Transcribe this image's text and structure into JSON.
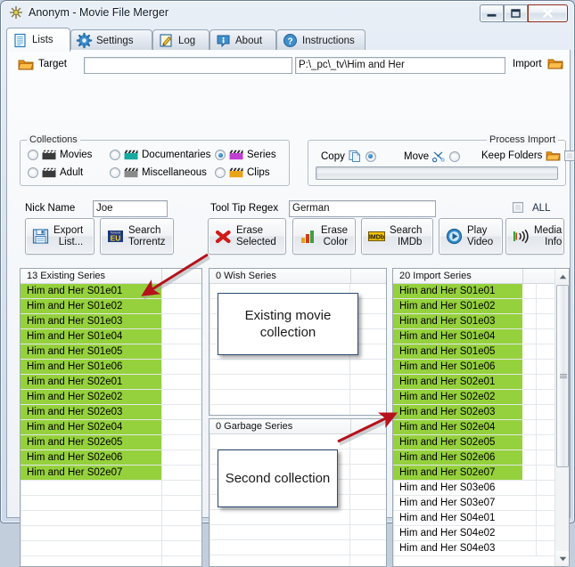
{
  "window": {
    "title": "Anonym - Movie File Merger",
    "icon": "app-star-icon",
    "buttons": {
      "minimize": "minimize-icon",
      "maximize": "maximize-icon",
      "close": "close-icon"
    }
  },
  "tabs": [
    {
      "label": "Lists",
      "icon": "document-icon",
      "active": true
    },
    {
      "label": "Settings",
      "icon": "gear-icon",
      "active": false
    },
    {
      "label": "Log",
      "icon": "pencil-note-icon",
      "active": false
    },
    {
      "label": "About",
      "icon": "info-bubble-icon",
      "active": false
    },
    {
      "label": "Instructions",
      "icon": "question-icon",
      "active": false
    }
  ],
  "target_row": {
    "folder_icon": "folder-icon",
    "label": "Target",
    "target_value": "",
    "target_placeholder": "",
    "import_path": "P:\\_pc\\_tv\\Him and Her",
    "import_label": "Import",
    "import_icon": "folder-icon"
  },
  "collections": {
    "title": "Collections",
    "items": [
      {
        "label": "Movies",
        "selected": false,
        "icon_color": "#3a3a3a"
      },
      {
        "label": "Documentaries",
        "selected": false,
        "icon_color": "#17a9a0"
      },
      {
        "label": "Series",
        "selected": true,
        "icon_color": "#c03fd0"
      },
      {
        "label": "Adult",
        "selected": false,
        "icon_color": "#3a3a3a"
      },
      {
        "label": "Miscellaneous",
        "selected": false,
        "icon_color": "#8a8a8a"
      },
      {
        "label": "Clips",
        "selected": false,
        "icon_color": "#e8a317"
      }
    ]
  },
  "process_import": {
    "title": "Process Import",
    "copy_label": "Copy",
    "copy_icon": "copy-pages-icon",
    "copy_selected": true,
    "move_label": "Move",
    "move_icon": "scissors-icon",
    "move_selected": false,
    "keep_folders_label": "Keep Folders",
    "keep_folders_icon": "folder-icon",
    "keep_folders_checked": false,
    "progress_percent": 0
  },
  "filters": {
    "nick_name_label": "Nick Name",
    "nick_name_value": "Joe",
    "regex_label": "Tool Tip Regex",
    "regex_value": "German",
    "all_label": "ALL",
    "all_checked": false
  },
  "buttons": [
    {
      "name": "export-list",
      "line1": "Export",
      "line2": "List...",
      "icon": "floppy-disk-icon"
    },
    {
      "name": "search-torrentz",
      "line1": "Search",
      "line2": "Torrentz",
      "icon": "torrentz-eu-icon"
    },
    {
      "name": "erase-selected",
      "line1": "Erase",
      "line2": "Selected",
      "icon": "red-x-icon"
    },
    {
      "name": "erase-color",
      "line1": "Erase",
      "line2": "Color",
      "icon": "bar-chart-icon"
    },
    {
      "name": "search-imdb",
      "line1": "Search",
      "line2": "IMDb",
      "icon": "imdb-icon"
    },
    {
      "name": "play-video",
      "line1": "Play",
      "line2": "Video",
      "icon": "play-icon"
    },
    {
      "name": "media-info",
      "line1": "Media",
      "line2": "Info",
      "icon": "media-info-icon"
    }
  ],
  "lists": {
    "existing": {
      "header": "13 Existing Series",
      "rows": [
        {
          "text": "Him and Her S01e01",
          "highlight": true
        },
        {
          "text": "Him and Her S01e02",
          "highlight": true
        },
        {
          "text": "Him and Her S01e03",
          "highlight": true
        },
        {
          "text": "Him and Her S01e04",
          "highlight": true
        },
        {
          "text": "Him and Her S01e05",
          "highlight": true
        },
        {
          "text": "Him and Her S01e06",
          "highlight": true
        },
        {
          "text": "Him and Her S02e01",
          "highlight": true
        },
        {
          "text": "Him and Her S02e02",
          "highlight": true
        },
        {
          "text": "Him and Her S02e03",
          "highlight": true
        },
        {
          "text": "Him and Her S02e04",
          "highlight": true
        },
        {
          "text": "Him and Her S02e05",
          "highlight": true
        },
        {
          "text": "Him and Her S02e06",
          "highlight": true
        },
        {
          "text": "Him and Her S02e07",
          "highlight": true
        },
        {
          "text": "",
          "highlight": false
        },
        {
          "text": "",
          "highlight": false
        },
        {
          "text": "",
          "highlight": false
        },
        {
          "text": "",
          "highlight": false
        },
        {
          "text": "",
          "highlight": false
        },
        {
          "text": "",
          "highlight": false
        }
      ]
    },
    "wish": {
      "header": "0 Wish Series",
      "rows": [
        {
          "text": "",
          "highlight": false
        },
        {
          "text": "",
          "highlight": false
        },
        {
          "text": "",
          "highlight": false
        },
        {
          "text": "",
          "highlight": false
        },
        {
          "text": "",
          "highlight": false
        },
        {
          "text": "",
          "highlight": false
        },
        {
          "text": "",
          "highlight": false
        },
        {
          "text": "",
          "highlight": false
        },
        {
          "text": "",
          "highlight": false
        }
      ]
    },
    "garbage": {
      "header": "0 Garbage Series",
      "rows": [
        {
          "text": "",
          "highlight": false
        },
        {
          "text": "",
          "highlight": false
        },
        {
          "text": "",
          "highlight": false
        },
        {
          "text": "",
          "highlight": false
        },
        {
          "text": "",
          "highlight": false
        },
        {
          "text": "",
          "highlight": false
        },
        {
          "text": "",
          "highlight": false
        },
        {
          "text": "",
          "highlight": false
        },
        {
          "text": "",
          "highlight": false
        }
      ]
    },
    "import": {
      "header": "20 Import Series",
      "rows": [
        {
          "text": "Him and Her S01e01",
          "highlight": true
        },
        {
          "text": "Him and Her S01e02",
          "highlight": true
        },
        {
          "text": "Him and Her S01e03",
          "highlight": true
        },
        {
          "text": "Him and Her S01e04",
          "highlight": true
        },
        {
          "text": "Him and Her S01e05",
          "highlight": true
        },
        {
          "text": "Him and Her S01e06",
          "highlight": true
        },
        {
          "text": "Him and Her S02e01",
          "highlight": true
        },
        {
          "text": "Him and Her S02e02",
          "highlight": true
        },
        {
          "text": "Him and Her S02e03",
          "highlight": true
        },
        {
          "text": "Him and Her S02e04",
          "highlight": true
        },
        {
          "text": "Him and Her S02e05",
          "highlight": true
        },
        {
          "text": "Him and Her S02e06",
          "highlight": true
        },
        {
          "text": "Him and Her S02e07",
          "highlight": true
        },
        {
          "text": "Him and Her S03e06",
          "highlight": false
        },
        {
          "text": "Him and Her S03e07",
          "highlight": false
        },
        {
          "text": "Him and Her S04e01",
          "highlight": false
        },
        {
          "text": "Him and Her S04e02",
          "highlight": false
        },
        {
          "text": "Him and Her S04e03",
          "highlight": false
        }
      ],
      "scrollbar": {
        "up": "scroll-up-arrow-icon",
        "down": "scroll-down-arrow-icon"
      }
    }
  },
  "callouts": [
    {
      "name": "callout-existing-collection",
      "text": "Existing movie collection"
    },
    {
      "name": "callout-second-collection",
      "text": "Second collection"
    }
  ],
  "colors": {
    "highlight_green": "#95d13c",
    "callout_border": "#2c4a73",
    "arrow_red": "#b5121b",
    "accent_blue": "#1c72b8"
  }
}
